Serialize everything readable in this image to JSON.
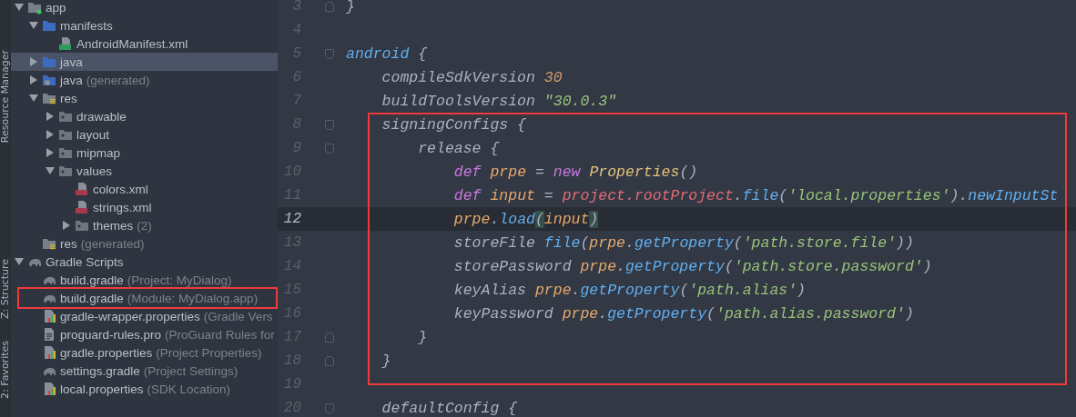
{
  "tool_strip": {
    "tabs": [
      {
        "label": "Resource Manager"
      },
      {
        "label": "Z: Structure"
      },
      {
        "label": "2: Favorites"
      }
    ]
  },
  "project_tree": {
    "nodes": [
      {
        "name": "app",
        "kind": "module",
        "expanded": true,
        "selected": false,
        "highlighted": false,
        "children": [
          {
            "name": "manifests",
            "kind": "folder-blue",
            "expanded": true,
            "selected": false,
            "highlighted": false,
            "children": [
              {
                "name": "AndroidManifest.xml",
                "kind": "manifest",
                "selected": false,
                "highlighted": false
              }
            ]
          },
          {
            "name": "java",
            "kind": "folder-blue",
            "expanded": false,
            "selected": true,
            "highlighted": false
          },
          {
            "name": "java",
            "suffix": "(generated)",
            "kind": "folder-gen",
            "expanded": false,
            "selected": false,
            "highlighted": false
          },
          {
            "name": "res",
            "kind": "folder-res",
            "expanded": true,
            "selected": false,
            "highlighted": false,
            "children": [
              {
                "name": "drawable",
                "kind": "folder-grey",
                "expanded": false,
                "selected": false,
                "highlighted": false
              },
              {
                "name": "layout",
                "kind": "folder-grey",
                "expanded": false,
                "selected": false,
                "highlighted": false
              },
              {
                "name": "mipmap",
                "kind": "folder-grey",
                "expanded": false,
                "selected": false,
                "highlighted": false
              },
              {
                "name": "values",
                "kind": "folder-grey",
                "expanded": true,
                "selected": false,
                "highlighted": false,
                "children": [
                  {
                    "name": "colors.xml",
                    "kind": "xml",
                    "selected": false,
                    "highlighted": false
                  },
                  {
                    "name": "strings.xml",
                    "kind": "xml",
                    "selected": false,
                    "highlighted": false
                  },
                  {
                    "name": "themes",
                    "suffix": "(2)",
                    "kind": "folder-grey",
                    "expanded": false,
                    "selected": false,
                    "highlighted": false
                  }
                ]
              }
            ]
          },
          {
            "name": "res",
            "suffix": "(generated)",
            "kind": "folder-res",
            "selected": false,
            "highlighted": false
          }
        ]
      },
      {
        "name": "Gradle Scripts",
        "kind": "gradle",
        "expanded": true,
        "selected": false,
        "highlighted": false,
        "children": [
          {
            "name": "build.gradle",
            "suffix": "(Project: MyDialog)",
            "kind": "gradle",
            "selected": false,
            "highlighted": false
          },
          {
            "name": "build.gradle",
            "suffix": "(Module: MyDialog.app)",
            "kind": "gradle",
            "selected": false,
            "highlighted": true
          },
          {
            "name": "gradle-wrapper.properties",
            "suffix": "(Gradle Vers",
            "kind": "properties",
            "selected": false,
            "highlighted": false
          },
          {
            "name": "proguard-rules.pro",
            "suffix": "(ProGuard Rules for",
            "kind": "text",
            "selected": false,
            "highlighted": false
          },
          {
            "name": "gradle.properties",
            "suffix": "(Project Properties)",
            "kind": "properties",
            "selected": false,
            "highlighted": false
          },
          {
            "name": "settings.gradle",
            "suffix": "(Project Settings)",
            "kind": "gradle",
            "selected": false,
            "highlighted": false
          },
          {
            "name": "local.properties",
            "suffix": "(SDK Location)",
            "kind": "properties",
            "selected": false,
            "highlighted": false
          }
        ]
      }
    ]
  },
  "editor": {
    "lines": [
      {
        "number": "3",
        "kind": "fold-end",
        "current": false,
        "boxed": false,
        "tokens": [
          {
            "text": "}",
            "kind": "plain"
          }
        ]
      },
      {
        "number": "4",
        "kind": "plain",
        "current": false,
        "boxed": false
      },
      {
        "number": "5",
        "kind": "fold-start",
        "current": false,
        "boxed": false,
        "tokens": [
          {
            "text": "android",
            "kind": "method"
          },
          {
            "text": " {",
            "kind": "plain"
          }
        ],
        "children": [
          {
            "number": "6",
            "kind": "plain",
            "current": false,
            "boxed": false,
            "tokens": [
              {
                "text": "compileSdkVersion ",
                "kind": "plain"
              },
              {
                "text": "30",
                "kind": "number"
              }
            ]
          },
          {
            "number": "7",
            "kind": "plain",
            "current": false,
            "boxed": false,
            "tokens": [
              {
                "text": "buildToolsVersion ",
                "kind": "plain"
              },
              {
                "text": "\"30.0.3\"",
                "kind": "string"
              }
            ]
          },
          {
            "number": "8",
            "kind": "fold-start",
            "current": false,
            "boxed": true,
            "tokens": [
              {
                "text": "signingConfigs {",
                "kind": "plain"
              }
            ],
            "children": [
              {
                "number": "9",
                "kind": "fold-start",
                "current": false,
                "boxed": true,
                "tokens": [
                  {
                    "text": "release {",
                    "kind": "plain"
                  }
                ],
                "children": [
                  {
                    "number": "10",
                    "kind": "plain",
                    "current": false,
                    "boxed": true,
                    "tokens": [
                      {
                        "text": "def",
                        "kind": "keyword"
                      },
                      {
                        "text": " prpe",
                        "kind": "variable"
                      },
                      {
                        "text": " = ",
                        "kind": "plain"
                      },
                      {
                        "text": "new",
                        "kind": "keyword"
                      },
                      {
                        "text": " Properties",
                        "kind": "class"
                      },
                      {
                        "text": "()",
                        "kind": "plain"
                      }
                    ]
                  },
                  {
                    "number": "11",
                    "kind": "plain",
                    "current": false,
                    "boxed": true,
                    "tokens": [
                      {
                        "text": "def",
                        "kind": "keyword"
                      },
                      {
                        "text": " input",
                        "kind": "variable"
                      },
                      {
                        "text": " = ",
                        "kind": "plain"
                      },
                      {
                        "text": "project.rootProject",
                        "kind": "field"
                      },
                      {
                        "text": ".",
                        "kind": "plain"
                      },
                      {
                        "text": "file",
                        "kind": "method"
                      },
                      {
                        "text": "(",
                        "kind": "plain"
                      },
                      {
                        "text": "'local.properties'",
                        "kind": "string"
                      },
                      {
                        "text": ").",
                        "kind": "plain"
                      },
                      {
                        "text": "newInputSt",
                        "kind": "method"
                      }
                    ]
                  },
                  {
                    "number": "12",
                    "kind": "plain",
                    "current": true,
                    "boxed": true,
                    "tokens": [
                      {
                        "text": "prpe",
                        "kind": "variable"
                      },
                      {
                        "text": ".",
                        "kind": "plain"
                      },
                      {
                        "text": "load",
                        "kind": "method"
                      },
                      {
                        "text": "(",
                        "kind": "brace-match"
                      },
                      {
                        "text": "input",
                        "kind": "variable"
                      },
                      {
                        "text": ")",
                        "kind": "brace-match"
                      }
                    ]
                  },
                  {
                    "number": "13",
                    "kind": "plain",
                    "current": false,
                    "boxed": true,
                    "tokens": [
                      {
                        "text": "storeFile ",
                        "kind": "plain"
                      },
                      {
                        "text": "file",
                        "kind": "method"
                      },
                      {
                        "text": "(",
                        "kind": "plain"
                      },
                      {
                        "text": "prpe",
                        "kind": "variable"
                      },
                      {
                        "text": ".",
                        "kind": "plain"
                      },
                      {
                        "text": "getProperty",
                        "kind": "method"
                      },
                      {
                        "text": "(",
                        "kind": "plain"
                      },
                      {
                        "text": "'path.store.file'",
                        "kind": "string"
                      },
                      {
                        "text": "))",
                        "kind": "plain"
                      }
                    ]
                  },
                  {
                    "number": "14",
                    "kind": "plain",
                    "current": false,
                    "boxed": true,
                    "tokens": [
                      {
                        "text": "storePassword ",
                        "kind": "plain"
                      },
                      {
                        "text": "prpe",
                        "kind": "variable"
                      },
                      {
                        "text": ".",
                        "kind": "plain"
                      },
                      {
                        "text": "getProperty",
                        "kind": "method"
                      },
                      {
                        "text": "(",
                        "kind": "plain"
                      },
                      {
                        "text": "'path.store.password'",
                        "kind": "string"
                      },
                      {
                        "text": ")",
                        "kind": "plain"
                      }
                    ]
                  },
                  {
                    "number": "15",
                    "kind": "plain",
                    "current": false,
                    "boxed": true,
                    "tokens": [
                      {
                        "text": "keyAlias ",
                        "kind": "plain"
                      },
                      {
                        "text": "prpe",
                        "kind": "variable"
                      },
                      {
                        "text": ".",
                        "kind": "plain"
                      },
                      {
                        "text": "getProperty",
                        "kind": "method"
                      },
                      {
                        "text": "(",
                        "kind": "plain"
                      },
                      {
                        "text": "'path.alias'",
                        "kind": "string"
                      },
                      {
                        "text": ")",
                        "kind": "plain"
                      }
                    ]
                  },
                  {
                    "number": "16",
                    "kind": "plain",
                    "current": false,
                    "boxed": true,
                    "tokens": [
                      {
                        "text": "keyPassword ",
                        "kind": "plain"
                      },
                      {
                        "text": "prpe",
                        "kind": "variable"
                      },
                      {
                        "text": ".",
                        "kind": "plain"
                      },
                      {
                        "text": "getProperty",
                        "kind": "method"
                      },
                      {
                        "text": "(",
                        "kind": "plain"
                      },
                      {
                        "text": "'path.alias.password'",
                        "kind": "string"
                      },
                      {
                        "text": ")",
                        "kind": "plain"
                      }
                    ]
                  }
                ]
              },
              {
                "number": "17",
                "kind": "fold-end",
                "current": false,
                "boxed": true,
                "tokens": [
                  {
                    "text": "}",
                    "kind": "plain"
                  }
                ]
              }
            ]
          },
          {
            "number": "18",
            "kind": "fold-end",
            "current": false,
            "boxed": true,
            "tokens": [
              {
                "text": "}",
                "kind": "plain"
              }
            ]
          },
          {
            "number": "19",
            "kind": "plain",
            "current": false,
            "boxed": true
          },
          {
            "number": "20",
            "kind": "fold-start",
            "current": false,
            "boxed": false,
            "tokens": [
              {
                "text": "defaultConfig {",
                "kind": "plain"
              }
            ]
          }
        ]
      }
    ]
  }
}
